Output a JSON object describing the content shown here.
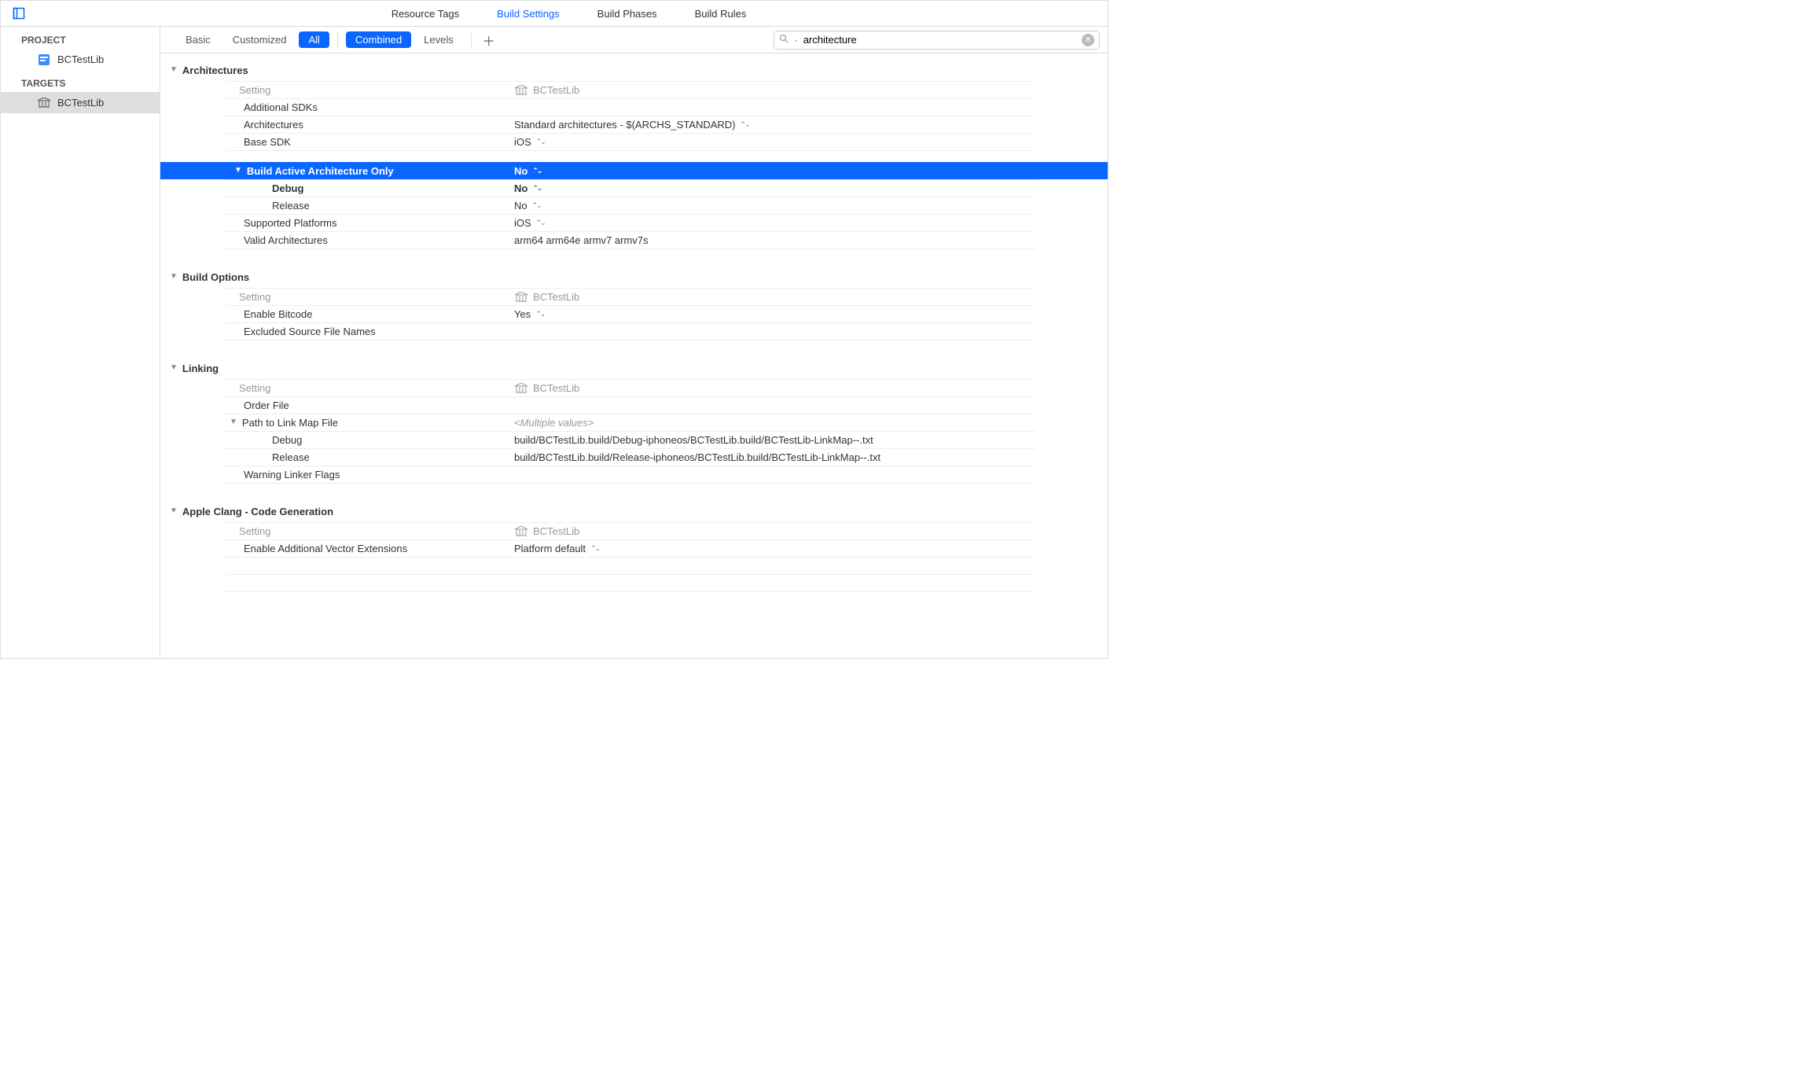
{
  "topTabs": {
    "resourceTags": "Resource Tags",
    "buildSettings": "Build Settings",
    "buildPhases": "Build Phases",
    "buildRules": "Build Rules"
  },
  "sidebar": {
    "projectLabel": "PROJECT",
    "targetsLabel": "TARGETS",
    "projectName": "BCTestLib",
    "targetName": "BCTestLib"
  },
  "toolbar": {
    "basic": "Basic",
    "customized": "Customized",
    "all": "All",
    "combined": "Combined",
    "levels": "Levels"
  },
  "search": {
    "value": "architecture"
  },
  "columnHeaders": {
    "setting": "Setting",
    "target": "BCTestLib"
  },
  "groups": {
    "architectures": {
      "title": "Architectures",
      "rows": {
        "additionalSDKs": {
          "label": "Additional SDKs",
          "value": ""
        },
        "architectures": {
          "label": "Architectures",
          "value": "Standard architectures  -  $(ARCHS_STANDARD)"
        },
        "baseSDK": {
          "label": "Base SDK",
          "value": "iOS"
        },
        "buildActiveArchOnly": {
          "label": "Build Active Architecture Only",
          "value": "No",
          "debug": {
            "label": "Debug",
            "value": "No"
          },
          "release": {
            "label": "Release",
            "value": "No"
          }
        },
        "supportedPlatforms": {
          "label": "Supported Platforms",
          "value": "iOS"
        },
        "validArch": {
          "label": "Valid Architectures",
          "value": "arm64 arm64e armv7 armv7s"
        }
      }
    },
    "buildOptions": {
      "title": "Build Options",
      "rows": {
        "enableBitcode": {
          "label": "Enable Bitcode",
          "value": "Yes"
        },
        "excludedSources": {
          "label": "Excluded Source File Names",
          "value": ""
        }
      }
    },
    "linking": {
      "title": "Linking",
      "rows": {
        "orderFile": {
          "label": "Order File",
          "value": ""
        },
        "pathToLinkMap": {
          "label": "Path to Link Map File",
          "value": "<Multiple values>",
          "debug": {
            "label": "Debug",
            "value": "build/BCTestLib.build/Debug-iphoneos/BCTestLib.build/BCTestLib-LinkMap--.txt"
          },
          "release": {
            "label": "Release",
            "value": "build/BCTestLib.build/Release-iphoneos/BCTestLib.build/BCTestLib-LinkMap--.txt"
          }
        },
        "warningLinkerFlags": {
          "label": "Warning Linker Flags",
          "value": ""
        }
      }
    },
    "appleClang": {
      "title": "Apple Clang - Code Generation",
      "rows": {
        "enableVectorExt": {
          "label": "Enable Additional Vector Extensions",
          "value": "Platform default"
        }
      }
    }
  }
}
